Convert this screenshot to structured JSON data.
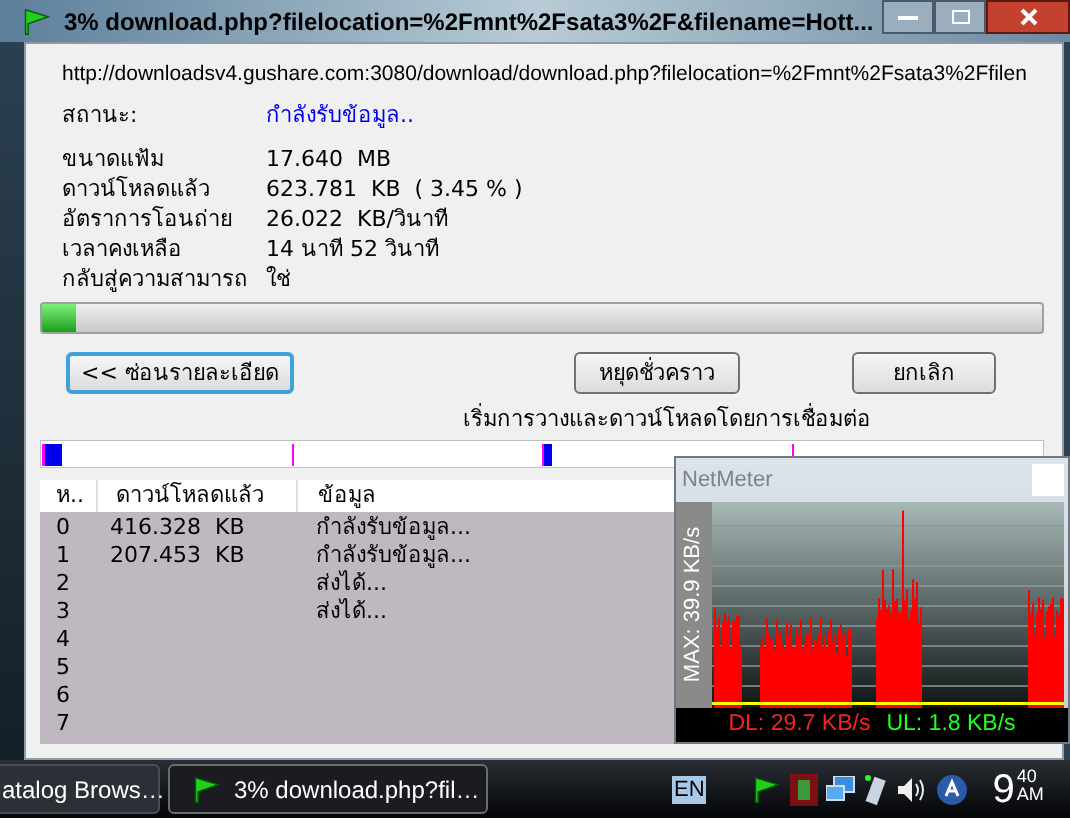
{
  "title_bar": {
    "title": "3% download.php?filelocation=%2Fmnt%2Fsata3%2F&filename=Hott..."
  },
  "url": "http://downloadsv4.gushare.com:3080/download/download.php?filelocation=%2Fmnt%2Fsata3%2Ffilen",
  "status": {
    "label": "สถานะ:",
    "value": "กำลังรับข้อมูล.."
  },
  "details": [
    {
      "label": "ขนาดแฟ้ม",
      "value": "17.640  MB"
    },
    {
      "label": "ดาวน์โหลดแล้ว",
      "value": "623.781  KB  ( 3.45 % )"
    },
    {
      "label": "อัตราการโอนถ่าย",
      "value": "26.022  KB/วินาที"
    },
    {
      "label": "เวลาคงเหลือ",
      "value": "14 นาที 52 วินาที"
    },
    {
      "label": "กลับสู่ความสามารถ",
      "value": "ใช่"
    }
  ],
  "progress": {
    "level": 0.034
  },
  "buttons": [
    {
      "label": "<< ซ่อนรายละเอียด",
      "focused": true
    },
    {
      "label": "หยุดชั่วคราว",
      "focused": false
    },
    {
      "label": "ยกเลิก",
      "focused": false
    }
  ],
  "caption": "เริ่มการวางและดาวน์โหลดโดยการเชื่อมต่อ",
  "table": {
    "columns": [
      "ห..",
      "ดาวน์โหลดแล้ว",
      "ข้อมูล"
    ],
    "rows": [
      {
        "number": "0",
        "downloaded": "416.328  KB",
        "info": "กำลังรับข้อมูล..."
      },
      {
        "number": "1",
        "downloaded": "207.453  KB",
        "info": "กำลังรับข้อมูล..."
      },
      {
        "number": "2",
        "info": "ส่งได้..."
      },
      {
        "number": "3",
        "info": "ส่งได้..."
      },
      {
        "number": "4"
      },
      {
        "number": "5"
      },
      {
        "number": "6"
      },
      {
        "number": "7"
      }
    ]
  },
  "netmeter": {
    "title": "NetMeter",
    "max_label": "MAX: 39.9 KB/s",
    "dl": "DL: 29.7 KB/s",
    "ul": "UL: 1.8 KB/s"
  },
  "taskbar": {
    "tasks": [
      {
        "label": "atalog Brows…",
        "selected": false
      },
      {
        "label": "3% download.php?fil…",
        "selected": true
      }
    ],
    "language": "EN",
    "clock": {
      "hour": "9",
      "minute": "40",
      "period": "AM"
    }
  }
}
